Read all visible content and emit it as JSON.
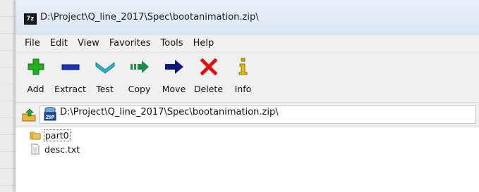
{
  "window": {
    "title": "D:\\Project\\Q_line_2017\\Spec\\bootanimation.zip\\",
    "app_icon_text": "7z"
  },
  "menu": [
    "File",
    "Edit",
    "View",
    "Favorites",
    "Tools",
    "Help"
  ],
  "toolbar": [
    {
      "label": "Add",
      "icon": "add-icon",
      "color": "#22b022"
    },
    {
      "label": "Extract",
      "icon": "extract-icon",
      "color": "#1b35b8"
    },
    {
      "label": "Test",
      "icon": "test-icon",
      "color": "#2bb6c9"
    },
    {
      "label": "Copy",
      "icon": "copy-icon",
      "color": "#1e8a4a"
    },
    {
      "label": "Move",
      "icon": "move-icon",
      "color": "#0b1a7a"
    },
    {
      "label": "Delete",
      "icon": "delete-icon",
      "color": "#e01010"
    },
    {
      "label": "Info",
      "icon": "info-icon",
      "color": "#d8a800"
    }
  ],
  "address": {
    "path": "D:\\Project\\Q_line_2017\\Spec\\bootanimation.zip\\"
  },
  "files": [
    {
      "name": "part0",
      "type": "folder",
      "selected": true
    },
    {
      "name": "desc.txt",
      "type": "file",
      "selected": false
    }
  ]
}
